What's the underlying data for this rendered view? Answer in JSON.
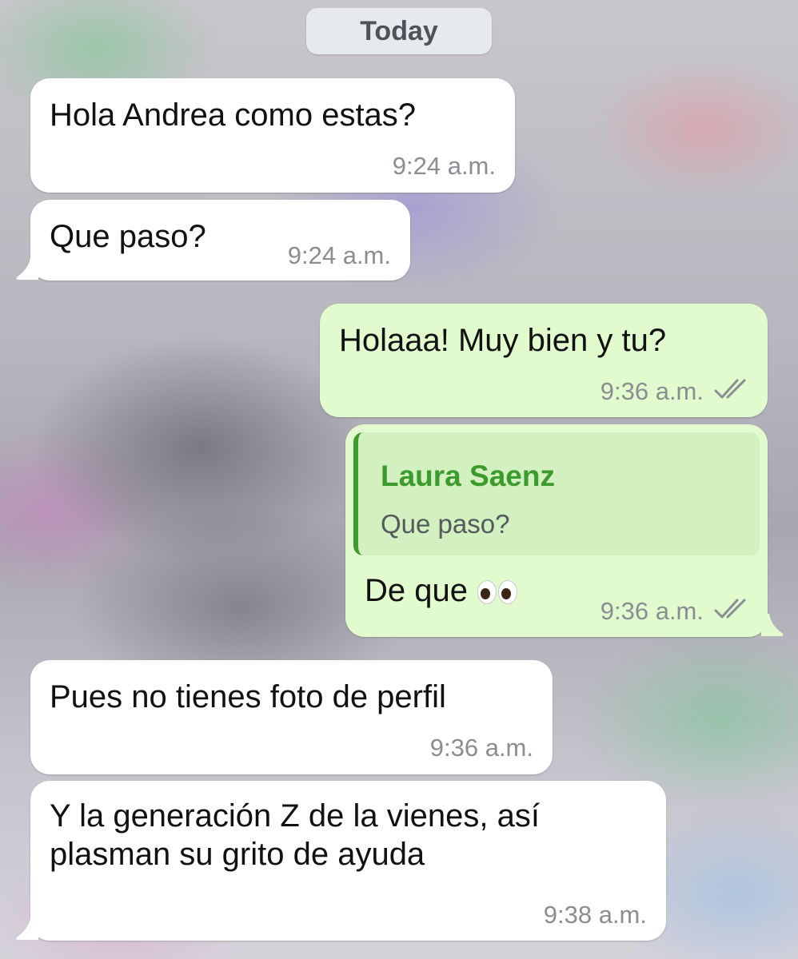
{
  "chat": {
    "date_label": "Today",
    "messages": [
      {
        "direction": "incoming",
        "text": "Hola Andrea como estas?",
        "time": "9:24 a.m."
      },
      {
        "direction": "incoming",
        "text": "Que paso?",
        "time": "9:24 a.m."
      },
      {
        "direction": "outgoing",
        "text": "Holaaa! Muy bien y tu?",
        "time": "9:36 a.m.",
        "status": "read-double-check"
      },
      {
        "direction": "outgoing",
        "reply_to": {
          "author": "Laura Saenz",
          "text": "Que paso?"
        },
        "text": "De que",
        "emoji": "eyes",
        "time": "9:36 a.m.",
        "status": "read-double-check"
      },
      {
        "direction": "incoming",
        "text": "Pues no tienes foto de perfil",
        "time": "9:36 a.m."
      },
      {
        "direction": "incoming",
        "text": "Y la generación Z de la vienes, así plasman su grito de ayuda",
        "time": "9:38 a.m."
      }
    ]
  },
  "colors": {
    "incoming_bubble": "#ffffff",
    "outgoing_bubble": "#e1fbcf",
    "quote_accent": "#3d9a2c",
    "timestamp": "#8a8d91"
  },
  "icons": {
    "status": "double-check-icon",
    "emoji": "eyes-emoji-icon"
  }
}
